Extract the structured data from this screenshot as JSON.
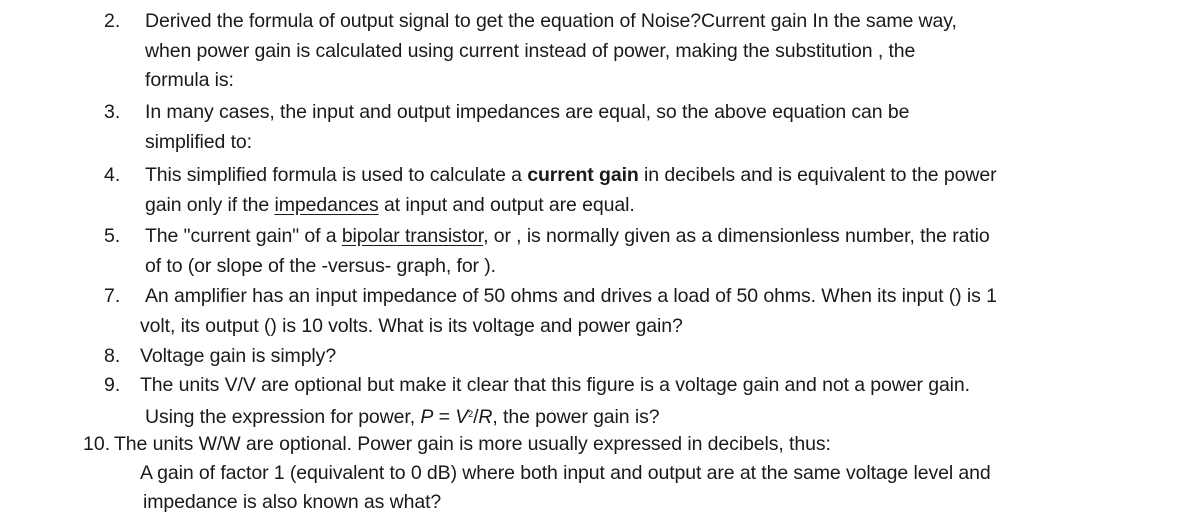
{
  "items": [
    {
      "number": "2.",
      "lines": [
        "Derived the formula of output signal to get the equation of Noise?Current gain  In the same way,",
        "when power gain is calculated using current instead of power, making the substitution , the",
        "formula is:"
      ]
    },
    {
      "number": "3.",
      "lines": [
        "In many cases, the input and output impedances are equal, so the above equation can be",
        "simplified to:"
      ]
    },
    {
      "number": "4.",
      "line1_pre": "This simplified formula is used to calculate a ",
      "line1_bold": "current gain",
      "line1_post": " in decibels and is equivalent to the power",
      "line2_pre": "gain only if the ",
      "line2_link": "impedances",
      "line2_post": " at input and output are equal."
    },
    {
      "number": "5.",
      "line1_pre": "The \"current gain\" of a ",
      "line1_link": "bipolar transistor",
      "line1_post": ", or , is normally given as a dimensionless number, the ratio",
      "line2": "of  to  (or slope of the -versus- graph, for )."
    },
    {
      "number": "7.",
      "lines": [
        "An amplifier has an input impedance of 50 ohms and drives a load of 50 ohms. When its input () is 1",
        "volt, its output () is 10 volts. What is its voltage and power gain?"
      ]
    },
    {
      "number": "8.",
      "lines": [
        "Voltage gain is simply?"
      ]
    },
    {
      "number": "9.",
      "line1": "The units V/V are optional but make it clear that this figure is a voltage gain and not a power gain.",
      "line2_pre": "Using the expression for power, ",
      "line2_formula_p": "P",
      "line2_formula_eq": " = ",
      "line2_formula_v": "V",
      "line2_formula_sup": "2",
      "line2_formula_slash": "/",
      "line2_formula_r": "R",
      "line2_post": ", the power gain is?"
    },
    {
      "number": "10.",
      "lines": [
        "The  units W/W are optional. Power gain is more usually expressed in decibels, thus:",
        "A gain of factor 1 (equivalent to 0 dB) where both input and output are at the same voltage level and",
        "impedance is also known as what?"
      ]
    }
  ]
}
